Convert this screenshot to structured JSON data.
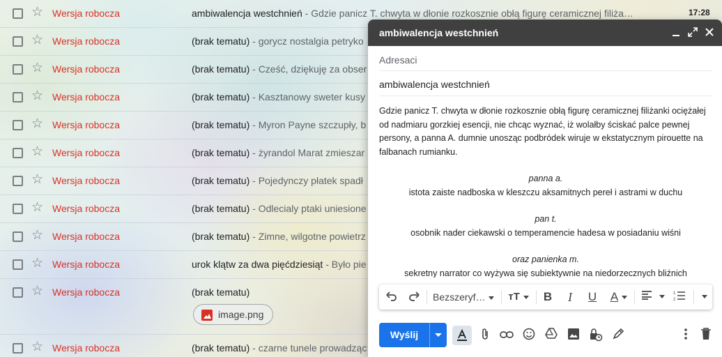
{
  "mail_list": [
    {
      "sender": "Wersja robocza",
      "subject": "ambiwalencja westchnień",
      "snippet": " - Gdzie panicz T. chwyta w dłonie rozkosznie obłą figurę ceramicznej filiża…",
      "time": "17:28"
    },
    {
      "sender": "Wersja robocza",
      "subject": "(brak tematu)",
      "snippet": " - gorycz nostalgia petryko"
    },
    {
      "sender": "Wersja robocza",
      "subject": "(brak tematu)",
      "snippet": " - Cześć, dziękuję za obser"
    },
    {
      "sender": "Wersja robocza",
      "subject": "(brak tematu)",
      "snippet": " - Kasztanowy sweter kusy"
    },
    {
      "sender": "Wersja robocza",
      "subject": "(brak tematu)",
      "snippet": " - Myron Payne szczupły, b"
    },
    {
      "sender": "Wersja robocza",
      "subject": "(brak tematu)",
      "snippet": " - żyrandol Marat zmieszar"
    },
    {
      "sender": "Wersja robocza",
      "subject": "(brak tematu)",
      "snippet": " - Pojedynczy płatek spadł"
    },
    {
      "sender": "Wersja robocza",
      "subject": "(brak tematu)",
      "snippet": " - Odlecialy ptaki uniesione"
    },
    {
      "sender": "Wersja robocza",
      "subject": "(brak tematu)",
      "snippet": " - Zimne, wilgotne powietrz"
    },
    {
      "sender": "Wersja robocza",
      "subject": "urok klątw za dwa pięćdziesiąt",
      "snippet": " - Było pie"
    },
    {
      "sender": "Wersja robocza",
      "subject": "(brak tematu)",
      "snippet": "",
      "attachment": "image.png"
    },
    {
      "sender": "Wersja robocza",
      "subject": "(brak tematu)",
      "snippet": " - czarne tunele prowadząc"
    }
  ],
  "compose": {
    "title": "ambiwalencja westchnień",
    "to_placeholder": "Adresaci",
    "subject": "ambiwalencja westchnień",
    "body": {
      "intro": "Gdzie panicz T. chwyta w dłonie rozkosznie obłą figurę ceramicznej filiżanki ociężałej od nadmiaru gorzkiej esencji, nie chcąc wyznać, iż wolałby ściskać palce pewnej persony, a panna A. dumnie unosząc podbródek wiruje w ekstatycznym pirouette na falbanach rumianku.",
      "c1_title": "panna a.",
      "c1_line": "istota zaiste nadboska w kleszczu aksamitnych pereł i astrami w duchu",
      "c2_title": "pan t.",
      "c2_line": "osobnik nader ciekawski o temperamencie hadesa w posiadaniu wiśni",
      "c3_title": "oraz panienka m.",
      "c3_line": "sekretny narrator co wyżywa się subiektywnie na niedorzecznych bliźnich"
    },
    "font_name": "Bezszeryf…",
    "send_label": "Wyślij"
  },
  "icons": {
    "minimize": "minimize-icon",
    "expand": "expand-icon",
    "close": "close-icon",
    "undo": "undo-icon",
    "redo": "redo-icon",
    "text_size": "text-size-icon",
    "bold": "bold-icon",
    "italic": "italic-icon",
    "underline": "underline-icon",
    "text_color": "text-color-icon",
    "align": "align-icon",
    "numbered_list": "numbered-list-icon",
    "attach": "paperclip-icon",
    "link": "link-icon",
    "emoji": "emoji-icon",
    "drive": "drive-icon",
    "photo": "photo-icon",
    "confidential": "lock-clock-icon",
    "signature": "pen-icon",
    "more": "more-vert-icon",
    "trash": "trash-icon"
  },
  "colors": {
    "draft_red": "#d93025",
    "send_blue": "#1a73e8",
    "compose_header": "#404040"
  }
}
